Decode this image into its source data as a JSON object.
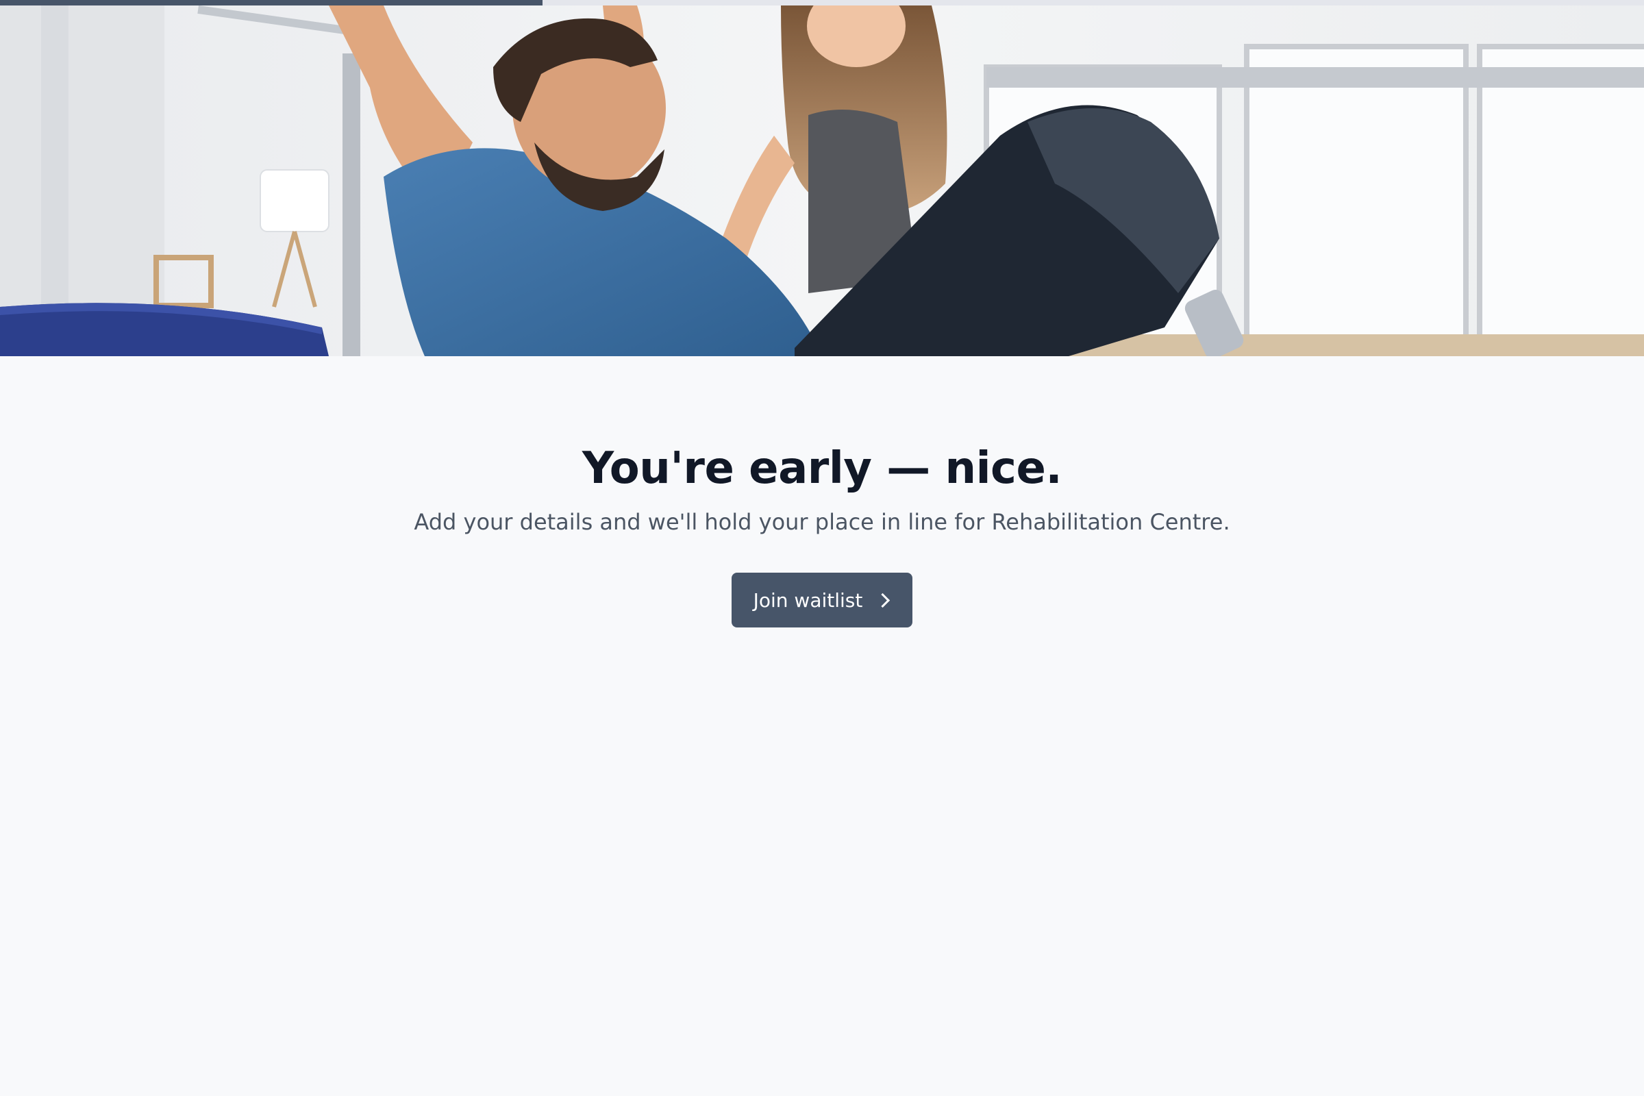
{
  "progress": {
    "fraction": 0.33
  },
  "hero": {
    "image_subject": "man doing rehabilitation exercise on pilates equipment with therapist"
  },
  "main": {
    "headline": "You're early — nice.",
    "subtitle": "Add your details and we'll hold your place in line for Rehabilitation Centre.",
    "cta_label": "Join waitlist",
    "cta_icon": "chevron-right-icon"
  },
  "colors": {
    "background": "#f8f9fb",
    "accent": "#475569",
    "headline": "#111827",
    "subtitle": "#4b5563"
  }
}
